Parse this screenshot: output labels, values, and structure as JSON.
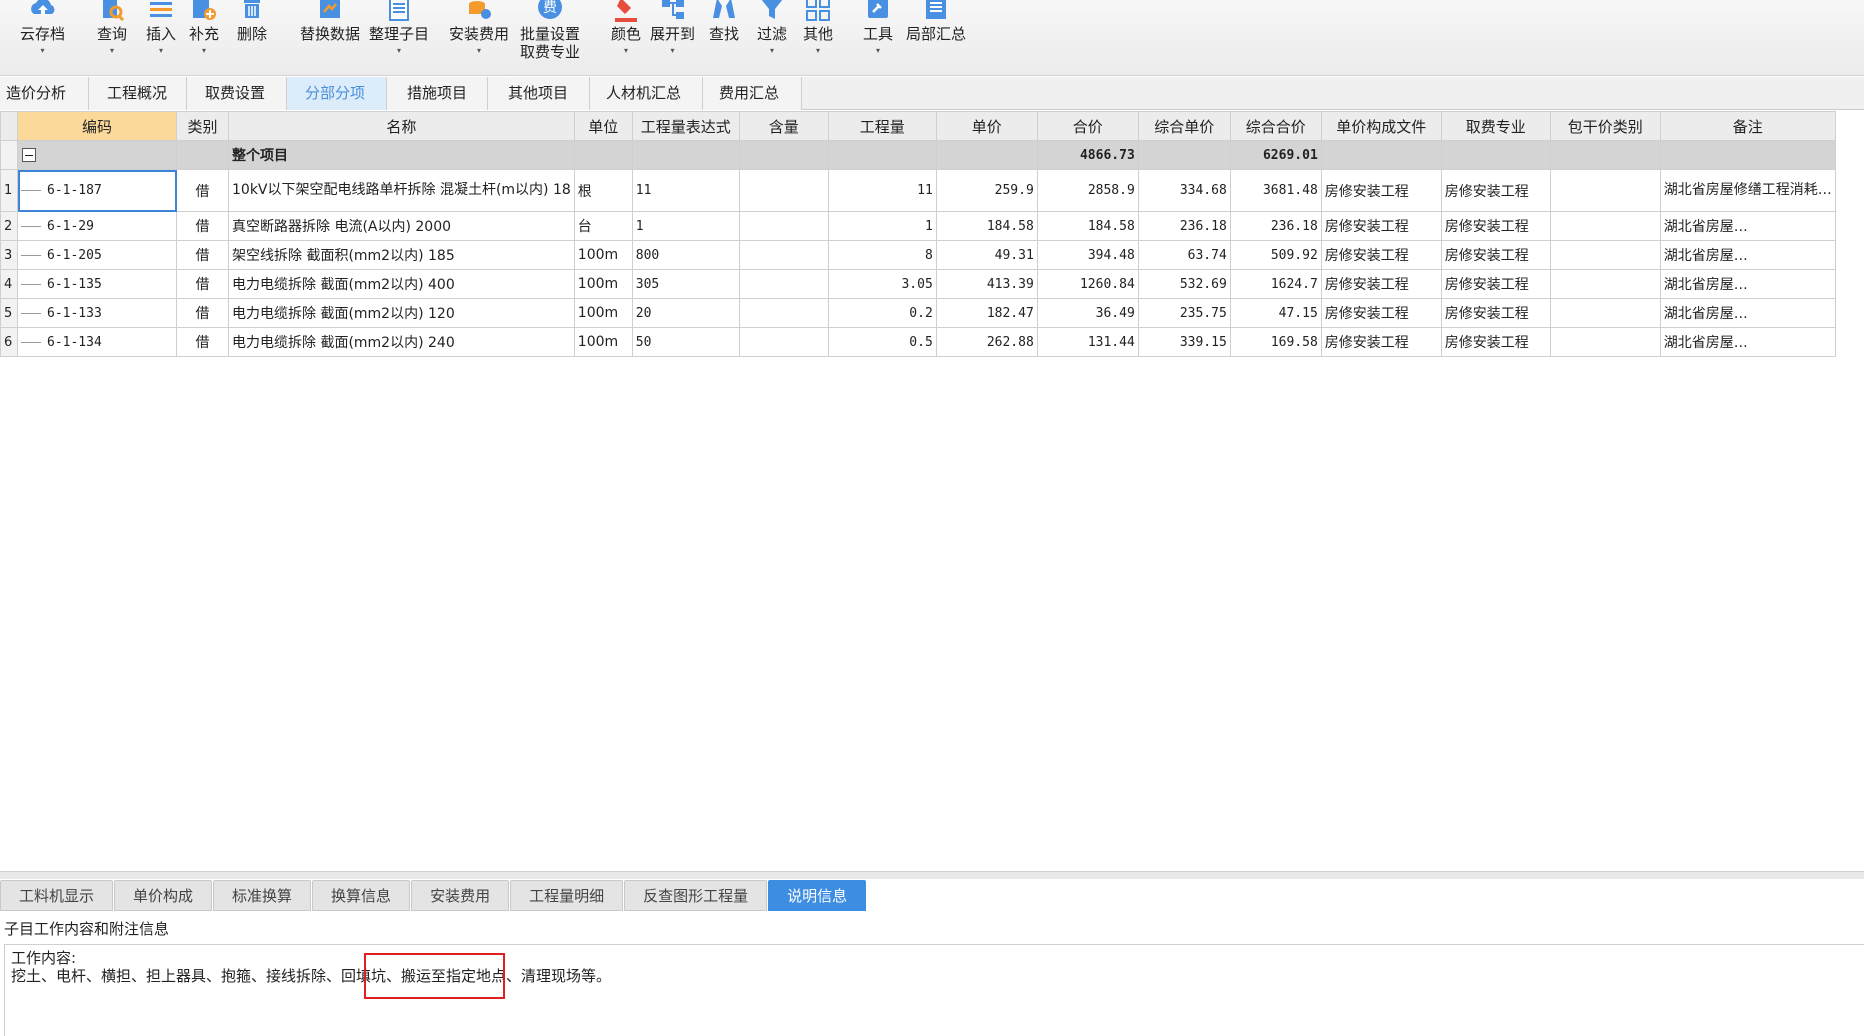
{
  "toolbar": {
    "items": [
      {
        "label": "云存档",
        "caret": "▾",
        "icon": "cloud-upload-icon"
      },
      {
        "label": "查询",
        "caret": "▾",
        "icon": "search-doc-icon"
      },
      {
        "label": "插入",
        "caret": "▾",
        "icon": "insert-icon"
      },
      {
        "label": "补充",
        "caret": "▾",
        "icon": "supplement-icon"
      },
      {
        "label": "删除",
        "icon": "delete-icon"
      },
      {
        "label": "替换数据",
        "icon": "replace-data-icon"
      },
      {
        "label": "整理子目",
        "caret": "▾",
        "icon": "organize-icon"
      },
      {
        "label": "安装费用",
        "caret": "▾",
        "icon": "install-fee-icon"
      },
      {
        "label": "批量设置",
        "label2": "取费专业",
        "icon": "fee-icon",
        "icon_text": "费"
      },
      {
        "label": "颜色",
        "caret": "▾",
        "icon": "color-icon"
      },
      {
        "label": "展开到",
        "caret": "▾",
        "icon": "expand-icon"
      },
      {
        "label": "查找",
        "icon": "find-icon"
      },
      {
        "label": "过滤",
        "caret": "▾",
        "icon": "filter-icon"
      },
      {
        "label": "其他",
        "caret": "▾",
        "icon": "other-icon"
      },
      {
        "label": "工具",
        "caret": "▾",
        "icon": "tools-icon"
      },
      {
        "label": "局部汇总",
        "icon": "partial-summary-icon"
      }
    ]
  },
  "top_tabs": [
    "造价分析",
    "工程概况",
    "取费设置",
    "分部分项",
    "措施项目",
    "其他项目",
    "人材机汇总",
    "费用汇总"
  ],
  "active_top_tab": 3,
  "table": {
    "headers": [
      "编码",
      "类别",
      "名称",
      "单位",
      "工程量表达式",
      "含量",
      "工程量",
      "单价",
      "合价",
      "综合单价",
      "综合合价",
      "单价构成文件",
      "取费专业",
      "包干价类别",
      "备注"
    ],
    "summary": {
      "name": "整个项目",
      "total_price": "4866.73",
      "comp_total": "6269.01"
    },
    "rows": [
      {
        "num": "1",
        "code": "6-1-187",
        "type": "借",
        "name": "10kV以下架空配电线路单杆拆除 混凝土杆(m以内) 18",
        "unit": "根",
        "expr": "11",
        "content": "",
        "qty": "11",
        "price": "259.9",
        "total": "2858.9",
        "comp_price": "334.68",
        "comp_total": "3681.48",
        "file": "房修安装工程",
        "fee": "房修安装工程",
        "pkg": "",
        "note": "湖北省房屋修缮工程消耗…"
      },
      {
        "num": "2",
        "code": "6-1-29",
        "type": "借",
        "name": "真空断路器拆除 电流(A以内) 2000",
        "unit": "台",
        "expr": "1",
        "content": "",
        "qty": "1",
        "price": "184.58",
        "total": "184.58",
        "comp_price": "236.18",
        "comp_total": "236.18",
        "file": "房修安装工程",
        "fee": "房修安装工程",
        "pkg": "",
        "note": "湖北省房屋…"
      },
      {
        "num": "3",
        "code": "6-1-205",
        "type": "借",
        "name": "架空线拆除 截面积(mm2以内) 185",
        "unit": "100m",
        "expr": "800",
        "content": "",
        "qty": "8",
        "price": "49.31",
        "total": "394.48",
        "comp_price": "63.74",
        "comp_total": "509.92",
        "file": "房修安装工程",
        "fee": "房修安装工程",
        "pkg": "",
        "note": "湖北省房屋…"
      },
      {
        "num": "4",
        "code": "6-1-135",
        "type": "借",
        "name": "电力电缆拆除 截面(mm2以内) 400",
        "unit": "100m",
        "expr": "305",
        "content": "",
        "qty": "3.05",
        "price": "413.39",
        "total": "1260.84",
        "comp_price": "532.69",
        "comp_total": "1624.7",
        "file": "房修安装工程",
        "fee": "房修安装工程",
        "pkg": "",
        "note": "湖北省房屋…"
      },
      {
        "num": "5",
        "code": "6-1-133",
        "type": "借",
        "name": "电力电缆拆除 截面(mm2以内) 120",
        "unit": "100m",
        "expr": "20",
        "content": "",
        "qty": "0.2",
        "price": "182.47",
        "total": "36.49",
        "comp_price": "235.75",
        "comp_total": "47.15",
        "file": "房修安装工程",
        "fee": "房修安装工程",
        "pkg": "",
        "note": "湖北省房屋…"
      },
      {
        "num": "6",
        "code": "6-1-134",
        "type": "借",
        "name": "电力电缆拆除 截面(mm2以内) 240",
        "unit": "100m",
        "expr": "50",
        "content": "",
        "qty": "0.5",
        "price": "262.88",
        "total": "131.44",
        "comp_price": "339.15",
        "comp_total": "169.58",
        "file": "房修安装工程",
        "fee": "房修安装工程",
        "pkg": "",
        "note": "湖北省房屋…"
      }
    ]
  },
  "bottom_tabs": [
    "工料机显示",
    "单价构成",
    "标准换算",
    "换算信息",
    "安装费用",
    "工程量明细",
    "反查图形工程量",
    "说明信息"
  ],
  "active_bottom_tab": 7,
  "info": {
    "title": "子目工作内容和附注信息",
    "line1": "工作内容:",
    "line2": "挖土、电杆、横担、担上器具、抱箍、接线拆除、回填坑、搬运至指定地点、清理现场等。"
  },
  "colors": {
    "accent": "#3d8ee3",
    "code_header": "#fbd99a",
    "highlight": "#e02020"
  }
}
